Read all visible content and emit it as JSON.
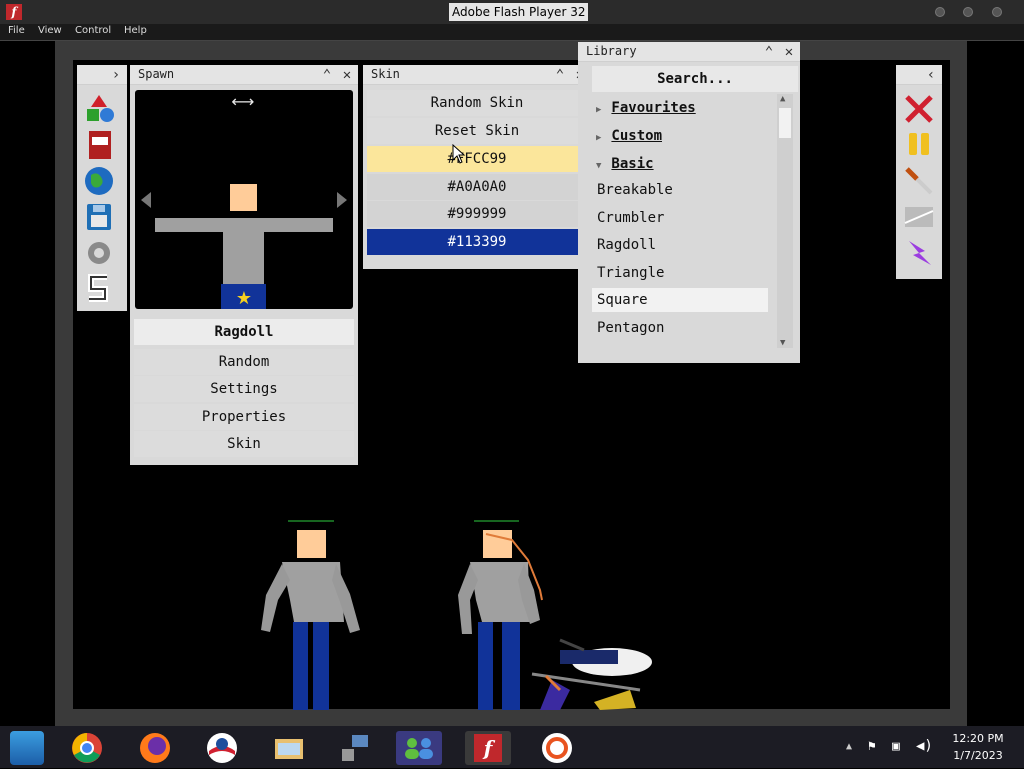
{
  "window": {
    "title": "Adobe Flash Player 32"
  },
  "menu": [
    "File",
    "View",
    "Control",
    "Help"
  ],
  "spawn_panel": {
    "title": "Spawn",
    "selected": "Ragdoll",
    "buttons": [
      "Random",
      "Settings",
      "Properties",
      "Skin"
    ]
  },
  "skin_panel": {
    "title": "Skin",
    "actions": [
      "Random Skin",
      "Reset Skin"
    ],
    "colors": [
      {
        "label": "#FFCC99",
        "color": "#fbe69b",
        "text_color": "#111"
      },
      {
        "label": "#A0A0A0",
        "color": "#d3d3d3",
        "text_color": "#111"
      },
      {
        "label": "#999999",
        "color": "#d3d3d3",
        "text_color": "#111"
      },
      {
        "label": "#113399",
        "color": "#113399",
        "text_color": "#ffffff"
      }
    ]
  },
  "library_panel": {
    "title": "Library",
    "search_placeholder": "Search...",
    "folders": [
      {
        "label": "Favourites",
        "expanded": false
      },
      {
        "label": "Custom",
        "expanded": false
      },
      {
        "label": "Basic",
        "expanded": true
      }
    ],
    "items": [
      "Breakable",
      "Crumbler",
      "Ragdoll",
      "Triangle",
      "Square",
      "Pentagon"
    ],
    "selected_item": "Square"
  },
  "taskbar": {
    "time": "12:20 PM",
    "date": "1/7/2023"
  }
}
